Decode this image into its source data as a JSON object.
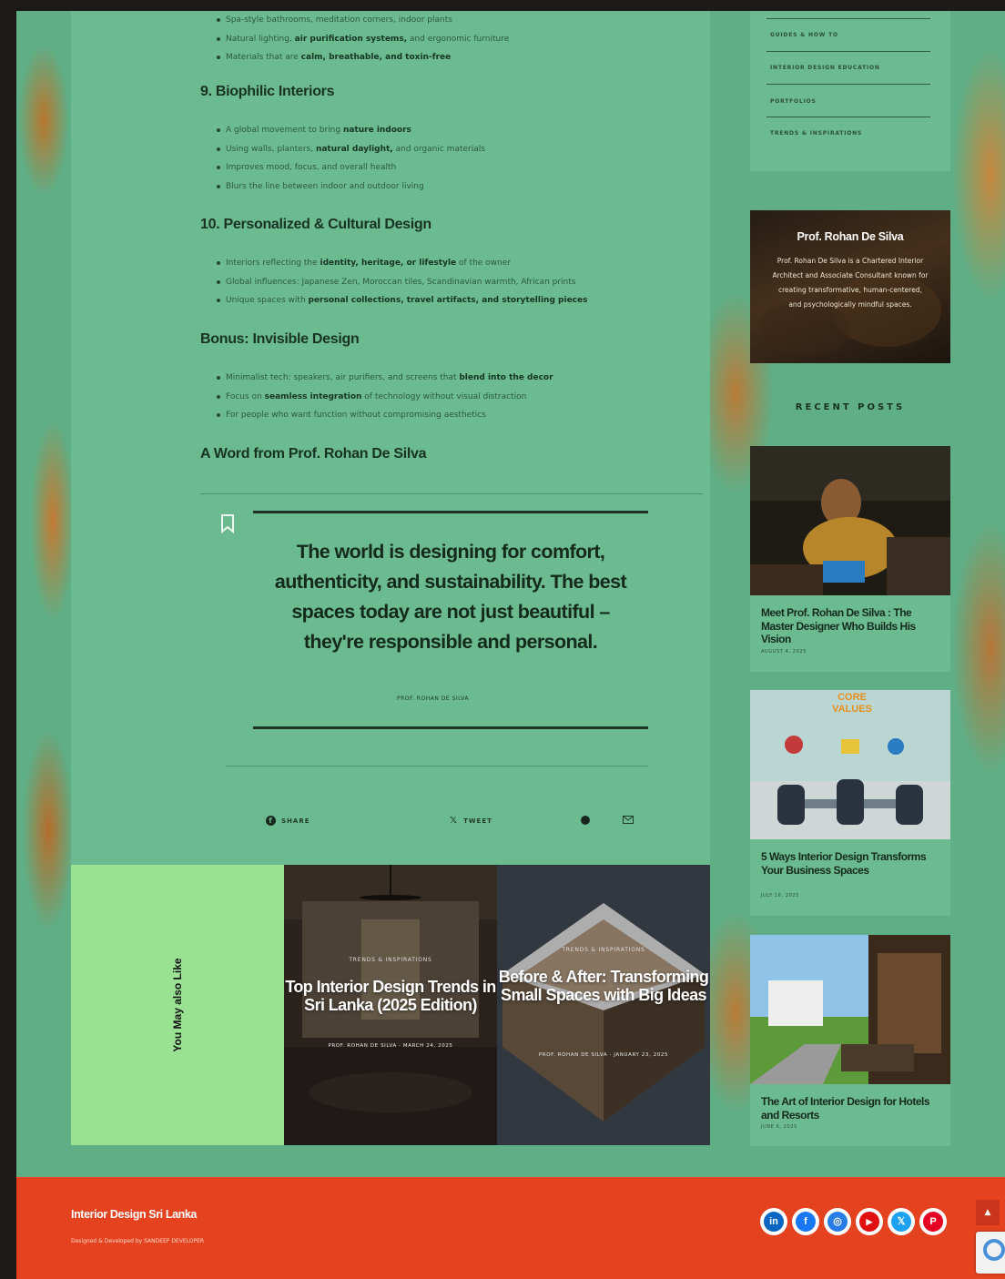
{
  "article": {
    "top_bullets": [
      {
        "pre": "Spa-style bathrooms, meditation corners, indoor plants",
        "bold": "",
        "post": ""
      },
      {
        "pre": "Natural lighting, ",
        "bold": "air purification systems,",
        "post": " and ergonomic furniture"
      },
      {
        "pre": "Materials that are ",
        "bold": "calm, breathable, and toxin-free",
        "post": ""
      }
    ],
    "sections": [
      {
        "title": "9. Biophilic Interiors",
        "bullets": [
          {
            "pre": "A global movement to bring ",
            "bold": "nature indoors",
            "post": ""
          },
          {
            "pre": "Using walls, planters, ",
            "bold": "natural daylight,",
            "post": " and organic materials"
          },
          {
            "pre": "Improves mood, focus, and overall health",
            "bold": "",
            "post": ""
          },
          {
            "pre": "Blurs the line between indoor and outdoor living",
            "bold": "",
            "post": ""
          }
        ]
      },
      {
        "title": "10. Personalized & Cultural Design",
        "bullets": [
          {
            "pre": "Interiors reflecting the ",
            "bold": "identity, heritage, or lifestyle",
            "post": " of the owner"
          },
          {
            "pre": "Global influences: Japanese Zen, Moroccan tiles, Scandinavian warmth, African prints",
            "bold": "",
            "post": ""
          },
          {
            "pre": "Unique spaces with ",
            "bold": "personal collections, travel artifacts, and storytelling pieces",
            "post": ""
          }
        ]
      },
      {
        "title": "Bonus: Invisible Design",
        "bullets": [
          {
            "pre": "Minimalist tech: speakers, air purifiers, and screens that ",
            "bold": "blend into the decor",
            "post": ""
          },
          {
            "pre": "Focus on ",
            "bold": "seamless integration",
            "post": " of technology without visual distraction"
          },
          {
            "pre": "For people who want function without compromising aesthetics",
            "bold": "",
            "post": ""
          }
        ]
      }
    ],
    "word_title": "A Word from Prof. Rohan De Silva",
    "quote": "The world is designing for comfort, authenticity, and sustainability. The best spaces today are not just beautiful – they're responsible and personal.",
    "quote_author": "PROF. ROHAN DE SILVA",
    "share": {
      "share_label": "SHARE",
      "tweet_label": "TWEET"
    }
  },
  "related": {
    "label": "You May also Like",
    "cards": [
      {
        "category": "TRENDS & INSPIRATIONS",
        "title": "Top Interior Design Trends in Sri Lanka (2025 Edition)",
        "meta": "PROF. ROHAN DE SILVA  ·  MARCH 24, 2025"
      },
      {
        "category": "TRENDS & INSPIRATIONS",
        "title": "Before & After: Transforming Small Spaces with Big Ideas",
        "meta": "PROF. ROHAN DE SILVA  ·  JANUARY 23, 2025"
      }
    ]
  },
  "sidebar": {
    "categories": [
      "GUIDES & HOW TO",
      "INTERIOR DESIGN EDUCATION",
      "PORTFOLIOS",
      "TRENDS & INSPIRATIONS"
    ],
    "author": {
      "name": "Prof. Rohan De Silva",
      "bio": "Prof. Rohan De Silva is a Chartered Interior Architect and Associate Consultant known for creating transformative, human-centered, and psychologically mindful spaces."
    },
    "recent_title": "RECENT POSTS",
    "posts": [
      {
        "title": "Meet Prof. Rohan De Silva : The Master Designer Who Builds His Vision",
        "date": "AUGUST 4, 2025"
      },
      {
        "title": "5 Ways Interior Design Transforms Your Business Spaces",
        "date": "JULY 16, 2025",
        "image_text": "CORE VALUES"
      },
      {
        "title": "The Art of Interior Design for Hotels and Resorts",
        "date": "JUNE 6, 2025"
      }
    ]
  },
  "footer": {
    "title": "Interior Design Sri Lanka",
    "credit": "Designed & Developed by SANDEEP DEVELOPER",
    "socials": [
      {
        "icon": "linkedin-icon",
        "glyph": "in",
        "color": "#0a66c2"
      },
      {
        "icon": "facebook-icon",
        "glyph": "f",
        "color": "#1877f2"
      },
      {
        "icon": "instagram-icon",
        "glyph": "◎",
        "color": "#2a7ce6"
      },
      {
        "icon": "youtube-icon",
        "glyph": "▶",
        "color": "#e10f0f"
      },
      {
        "icon": "x-icon",
        "glyph": "𝕏",
        "color": "#1da1f2"
      },
      {
        "icon": "pinterest-icon",
        "glyph": "P",
        "color": "#e60023"
      }
    ],
    "to_top": "▲"
  },
  "colors": {
    "page_green": "#6cba8f",
    "related_label_bg": "#98e292",
    "footer_bg": "#e5431f",
    "heading": "#173323"
  }
}
